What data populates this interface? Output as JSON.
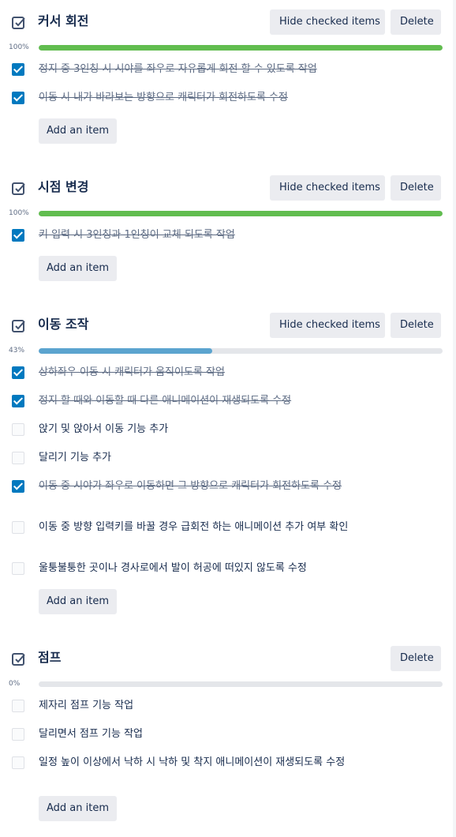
{
  "checklists": [
    {
      "title": "커서 회전",
      "hide_label": "Hide checked items",
      "delete_label": "Delete",
      "progress_label": "100%",
      "progress": 1.0,
      "items": [
        {
          "text": "정지 중 3인칭 시 시야를 좌우로 자유롭게 회전 할 수 있도록 작업",
          "checked": true
        },
        {
          "text": "이동 시 내가 바라보는 방향으로 캐릭터가 회전하도록 수정",
          "checked": true
        }
      ],
      "add_label": "Add an item"
    },
    {
      "title": "시점 변경",
      "hide_label": "Hide checked items",
      "delete_label": "Delete",
      "progress_label": "100%",
      "progress": 1.0,
      "items": [
        {
          "text": "키 입력 시 3인칭과 1인칭이 교체 되도록 작업",
          "checked": true
        }
      ],
      "add_label": "Add an item"
    },
    {
      "title": "이동 조작",
      "hide_label": "Hide checked items",
      "delete_label": "Delete",
      "progress_label": "43%",
      "progress": 0.43,
      "items": [
        {
          "text": "상하좌우 이동 시 캐릭터가 움직이도록 작업",
          "checked": true
        },
        {
          "text": "정지 할 때와 이동할 때 다른 애니메이션이 재생되도록 수정",
          "checked": true
        },
        {
          "text": "앉기 및 앉아서 이동 기능 추가",
          "checked": false
        },
        {
          "text": "달리기 기능 추가",
          "checked": false
        },
        {
          "text": "이동 중 시야가 좌우로 이동하면 그 방향으로 캐릭터가 회전하도록 수정",
          "checked": true
        },
        {
          "text": "이동 중 방향 입력키를 바꿀 경우 급회전 하는 애니메이션 추가 여부 확인",
          "checked": false
        },
        {
          "text": "울퉁불퉁한 곳이나 경사로에서 발이 허공에 떠있지 않도록 수정",
          "checked": false
        }
      ],
      "add_label": "Add an item"
    },
    {
      "title": "점프",
      "delete_label": "Delete",
      "progress_label": "0%",
      "progress": 0.0,
      "items": [
        {
          "text": "제자리 점프 기능 작업",
          "checked": false
        },
        {
          "text": "달리면서 점프 기능 작업",
          "checked": false
        },
        {
          "text": "일정 높이 이상에서 낙하 시 낙하 및 착지 애니메이션이 재생되도록 수정",
          "checked": false
        }
      ],
      "add_label": "Add an item"
    }
  ]
}
